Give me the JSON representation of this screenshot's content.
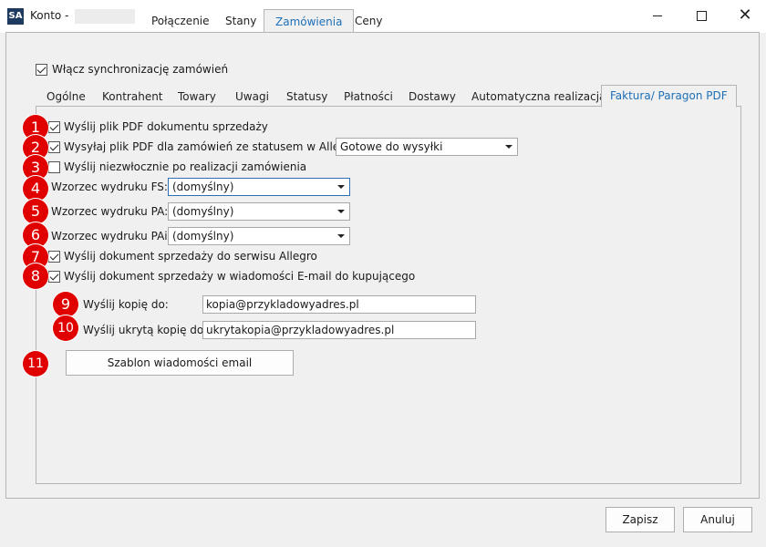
{
  "window": {
    "app_icon": "SA",
    "title": "Konto -"
  },
  "top_tabs": [
    "Połączenie",
    "Stany",
    "Zamówienia",
    "Ceny"
  ],
  "enable_sync": {
    "label": "Włącz synchronizację zamówień",
    "checked": true
  },
  "sub_tabs": [
    "Ogólne",
    "Kontrahent",
    "Towary",
    "Uwagi",
    "Statusy",
    "Płatności",
    "Dostawy",
    "Automatyczna realizacja",
    "Faktura/ Paragon PDF"
  ],
  "options": {
    "send_pdf": {
      "label": "Wyślij plik PDF dokumentu sprzedaży",
      "checked": true
    },
    "send_pdf_status": {
      "label": "Wysyłaj plik PDF dla zamówień ze statusem w Allegro:",
      "checked": true,
      "value": "Gotowe do wysyłki"
    },
    "send_immediately": {
      "label": "Wyślij niezwłocznie po realizacji zamówienia",
      "checked": false
    },
    "template_fs": {
      "label": "Wzorzec wydruku FS:",
      "value": "(domyślny)"
    },
    "template_pa": {
      "label": "Wzorzec wydruku PA:",
      "value": "(domyślny)"
    },
    "template_pai": {
      "label": "Wzorzec wydruku PAi:",
      "value": "(domyślny)"
    },
    "send_allegro": {
      "label": "Wyślij dokument sprzedaży do serwisu Allegro",
      "checked": true
    },
    "send_email": {
      "label": "Wyślij dokument sprzedaży w wiadomości E-mail do kupującego",
      "checked": true
    },
    "cc": {
      "label": "Wyślij kopię do:",
      "value": "kopia@przykladowyadres.pl"
    },
    "bcc": {
      "label": "Wyślij ukrytą kopię do:",
      "value": "ukrytakopia@przykladowyadres.pl"
    },
    "email_template_button": "Szablon wiadomości email"
  },
  "badges": [
    "1",
    "2",
    "3",
    "4",
    "5",
    "6",
    "7",
    "8",
    "9",
    "10",
    "11"
  ],
  "footer": {
    "save": "Zapisz",
    "cancel": "Anuluj"
  },
  "icons": {
    "minimize": "minimize-icon",
    "maximize": "maximize-icon",
    "close": "close-icon",
    "checkmark": "check-icon",
    "dropdown": "chevron-down-icon"
  },
  "colors": {
    "accent": "#1c6fb8",
    "badge": "#e00000"
  }
}
